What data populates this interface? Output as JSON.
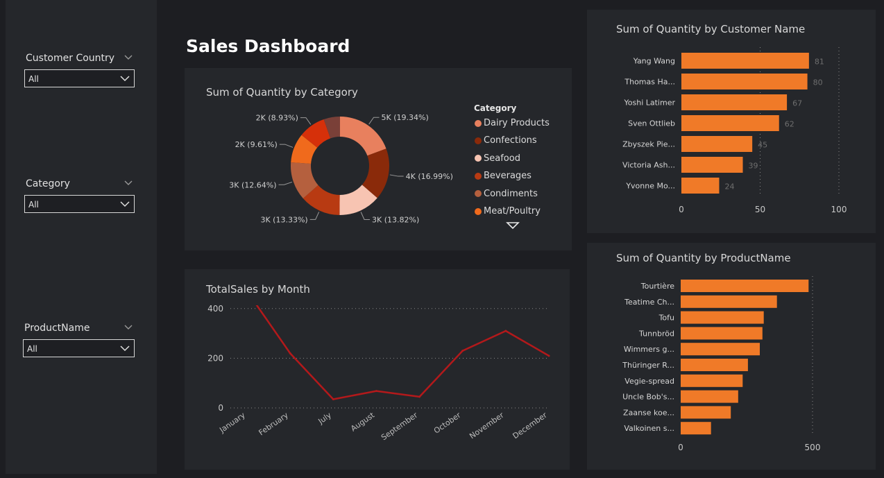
{
  "page_title": "Sales Dashboard",
  "slicers": [
    {
      "title": "Customer Country",
      "value": "All"
    },
    {
      "title": "Category",
      "value": "All"
    },
    {
      "title": "ProductName",
      "value": "All"
    }
  ],
  "colors": {
    "background": "#1d1e22",
    "panel": "#25272b",
    "bar": "#f07a28",
    "line": "#b3191b",
    "donut": [
      "#e8805e",
      "#8a2a0a",
      "#f7c4b2",
      "#b83a12",
      "#b5603e",
      "#f06a1c",
      "#d6300a",
      "#7a4038"
    ]
  },
  "legend_more_icon": "triangle-down-icon",
  "chart_data": [
    {
      "type": "pie",
      "title": "Sum of Quantity by Category",
      "legend_title": "Category",
      "legend_entries": [
        "Dairy Products",
        "Confections",
        "Seafood",
        "Beverages",
        "Condiments",
        "Meat/Poultry"
      ],
      "slices": [
        {
          "label": "5K (19.34%)",
          "percent": 19.34
        },
        {
          "label": "4K (16.99%)",
          "percent": 16.99
        },
        {
          "label": "3K (13.82%)",
          "percent": 13.82
        },
        {
          "label": "3K (13.33%)",
          "percent": 13.33
        },
        {
          "label": "3K (12.64%)",
          "percent": 12.64
        },
        {
          "label": "2K (9.61%)",
          "percent": 9.61
        },
        {
          "label": "2K (8.93%)",
          "percent": 8.93
        },
        {
          "label": "",
          "percent": 5.34
        }
      ]
    },
    {
      "type": "line",
      "title": "TotalSales by Month",
      "categories": [
        "January",
        "February",
        "July",
        "August",
        "September",
        "October",
        "November",
        "December"
      ],
      "values": [
        470,
        220,
        35,
        68,
        45,
        230,
        310,
        210
      ],
      "yticks": [
        0,
        200,
        400
      ],
      "ylim": [
        0,
        500
      ]
    },
    {
      "type": "bar",
      "orientation": "horizontal",
      "title": "Sum of Quantity by Customer Name",
      "categories": [
        "Yang Wang",
        "Thomas Ha...",
        "Yoshi Latimer",
        "Sven Ottlieb",
        "Zbyszek Pie...",
        "Victoria Ash...",
        "Yvonne Mo..."
      ],
      "values": [
        81,
        80,
        67,
        62,
        45,
        39,
        24
      ],
      "xticks": [
        0,
        50,
        100
      ],
      "xlim": [
        0,
        100
      ]
    },
    {
      "type": "bar",
      "orientation": "horizontal",
      "title": "Sum of Quantity by ProductName",
      "categories": [
        "Tourtière",
        "Teatime Ch...",
        "Tofu",
        "Tunnbröd",
        "Wimmers g...",
        "Thüringer R...",
        "Vegie-spread",
        "Uncle Bob's...",
        "Zaanse koe...",
        "Valkoinen s..."
      ],
      "values": [
        485,
        365,
        315,
        310,
        300,
        255,
        235,
        218,
        190,
        115
      ],
      "xticks": [
        0,
        500
      ],
      "xlim": [
        0,
        500
      ]
    }
  ]
}
